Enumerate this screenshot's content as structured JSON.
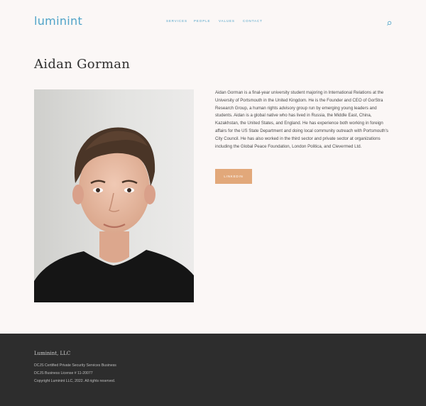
{
  "header": {
    "logo": "luminint",
    "nav": [
      {
        "label": "SERVICES"
      },
      {
        "label": "PEOPLE"
      },
      {
        "label": "VALUES"
      },
      {
        "label": "CONTACT"
      }
    ],
    "search_icon": "search-icon",
    "accent_color": "#4fa3c8"
  },
  "profile": {
    "name": "Aidan Gorman",
    "bio": "Aidan Gorman is a final-year university student majoring in International Relations at the University of Portsmouth in the United Kingdom. He is the Founder and CEO of GorStra Research Group, a human rights advisory group run by emerging young leaders and students. Aidan is a global native who has lived in Russia, the Middle East, China, Kazakhstan, the United States, and England. He has experience both working in foreign affairs for the US State Department and doing local community outreach with Portsmouth's City Council. He has also worked in the third sector and private sector at organizations including the Global Peace Foundation, London Politica, and Clevermed Ltd.",
    "linkedin_label": "LINKEDIN",
    "button_color": "#e2a87a"
  },
  "footer": {
    "brand": "Luminint, LLC",
    "lines": [
      "DCJS Certified Private Security Services Business",
      "DCJS Business License # 11-20077",
      "Copyright Luminint LLC, 2022.  All rights reserved."
    ],
    "background_color": "#2d2d2d"
  }
}
